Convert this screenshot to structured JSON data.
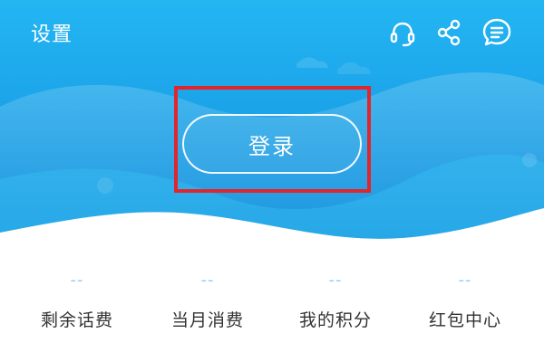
{
  "header": {
    "title": "设置",
    "login_label": "登录",
    "icons": [
      "headset-icon",
      "share-icon",
      "message-icon"
    ]
  },
  "stats": [
    {
      "value": "--",
      "label": "剩余话费"
    },
    {
      "value": "--",
      "label": "当月消费"
    },
    {
      "value": "--",
      "label": "我的积分"
    },
    {
      "value": "--",
      "label": "红包中心"
    }
  ],
  "colors": {
    "header_blue": "#1a9fe6",
    "highlight_red": "#e0262c",
    "stat_value": "#9cc8ee",
    "stat_label": "#333333"
  }
}
